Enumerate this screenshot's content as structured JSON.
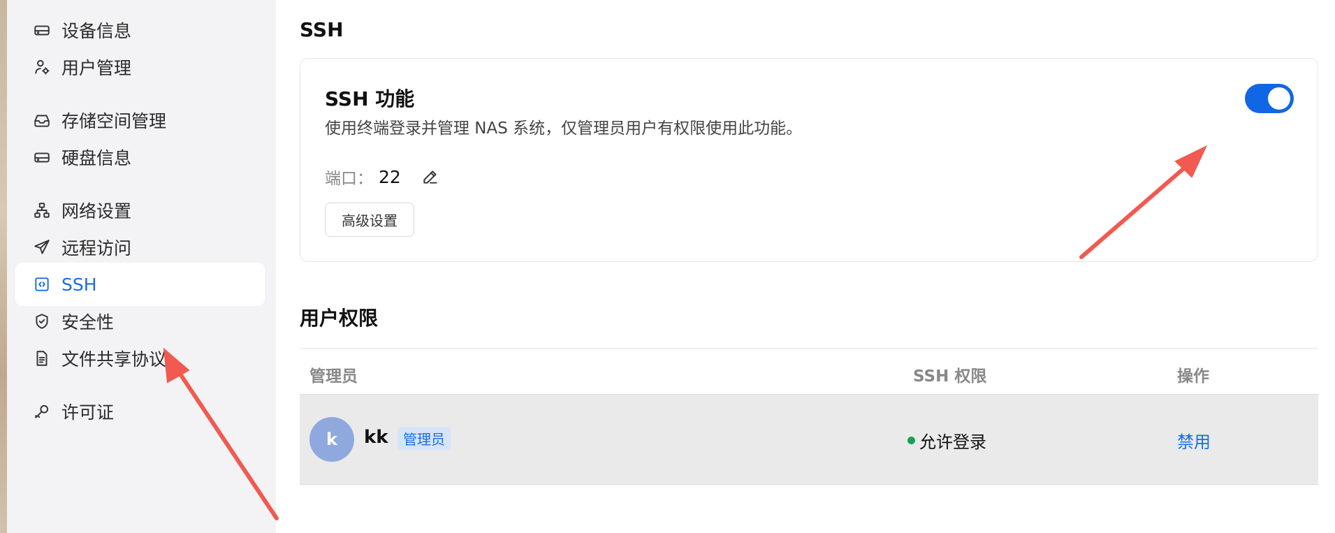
{
  "sidebar": {
    "items": [
      {
        "label": "设备信息",
        "icon": "storage-icon"
      },
      {
        "label": "用户管理",
        "icon": "user-settings-icon"
      },
      {
        "label": "存储空间管理",
        "icon": "inbox-icon"
      },
      {
        "label": "硬盘信息",
        "icon": "drive-icon"
      },
      {
        "label": "网络设置",
        "icon": "network-icon"
      },
      {
        "label": "远程访问",
        "icon": "send-icon"
      },
      {
        "label": "SSH",
        "icon": "terminal-icon",
        "active": true
      },
      {
        "label": "安全性",
        "icon": "shield-icon"
      },
      {
        "label": "文件共享协议",
        "icon": "file-icon"
      },
      {
        "label": "许可证",
        "icon": "key-icon"
      }
    ]
  },
  "main": {
    "section_title": "SSH",
    "ssh_card": {
      "title": "SSH 功能",
      "description": "使用终端登录并管理 NAS 系统，仅管理员用户有权限使用此功能。",
      "port_label": "端口：",
      "port_value": "22",
      "advanced_button": "高级设置",
      "enabled": true
    },
    "permissions_title": "用户权限",
    "table": {
      "headers": {
        "user": "管理员",
        "permission": "SSH 权限",
        "action": "操作"
      },
      "rows": [
        {
          "avatar": "k",
          "name": "kk",
          "role": "管理员",
          "status": "允许登录",
          "action": "禁用"
        }
      ]
    }
  },
  "colors": {
    "accent": "#1166e6",
    "status_green": "#16a05a",
    "annotation_arrow": "#f05a50"
  }
}
